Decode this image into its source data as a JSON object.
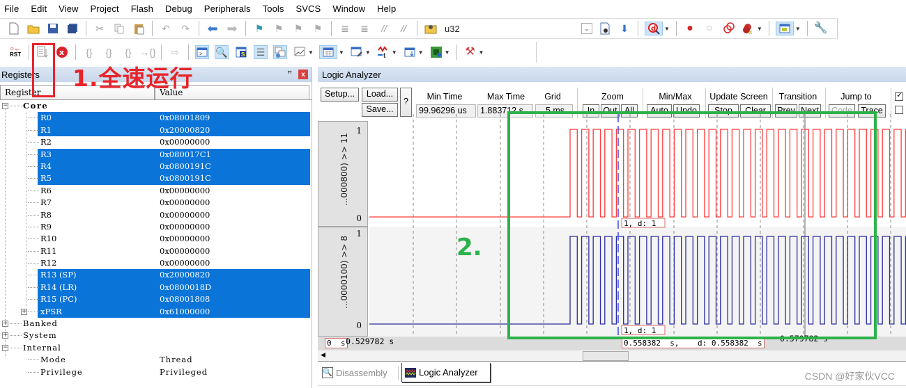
{
  "menu": [
    "File",
    "Edit",
    "View",
    "Project",
    "Flash",
    "Debug",
    "Peripherals",
    "Tools",
    "SVCS",
    "Window",
    "Help"
  ],
  "toolbar1": {
    "icons": [
      "new-file-icon",
      "open-folder-icon",
      "save-icon",
      "save-all-icon",
      "cut-icon",
      "copy-icon",
      "paste-icon",
      "undo-icon",
      "redo-icon",
      "navigate-back-icon",
      "navigate-forward-icon",
      "bookmark-icon",
      "prev-bookmark-icon",
      "next-bookmark-icon",
      "clear-bookmarks-icon",
      "indent-icon",
      "unindent-icon",
      "comment-icon",
      "uncomment-icon",
      "find-in-files-icon"
    ],
    "search_text": "u32",
    "right_icons": [
      "dropdown-icon",
      "find-icon",
      "incremental-find-icon",
      "debug-session-icon",
      "breakpoint-icon",
      "disable-breakpoint-icon",
      "disable-all-breakpoints-icon",
      "kill-all-breakpoints-icon",
      "window-layout-icon",
      "configure-icon"
    ]
  },
  "toolbar2": {
    "icons": [
      "reset-icon",
      "run-icon",
      "stop-icon",
      "step-into-icon",
      "step-over-icon",
      "step-out-icon",
      "run-to-cursor-icon",
      "show-next-statement-icon",
      "command-window-icon",
      "disassembly-window-icon",
      "symbols-window-icon",
      "registers-window-icon",
      "call-stack-icon",
      "watch-windows-icon",
      "memory-windows-icon",
      "serial-windows-icon",
      "analysis-windows-icon",
      "trace-windows-icon",
      "system-viewer-icon",
      "toolbox-icon"
    ],
    "reset_label": "RST"
  },
  "registers": {
    "title": "Registers",
    "col_register": "Register",
    "col_value": "Value",
    "groups": {
      "core": "Core",
      "banked": "Banked",
      "system": "System",
      "internal": "Internal"
    },
    "core": [
      {
        "name": "R0",
        "value": "0x08001809",
        "selected": true
      },
      {
        "name": "R1",
        "value": "0x20000820",
        "selected": true
      },
      {
        "name": "R2",
        "value": "0x00000000",
        "selected": false
      },
      {
        "name": "R3",
        "value": "0x080017C1",
        "selected": true
      },
      {
        "name": "R4",
        "value": "0x0800191C",
        "selected": true
      },
      {
        "name": "R5",
        "value": "0x0800191C",
        "selected": true
      },
      {
        "name": "R6",
        "value": "0x00000000",
        "selected": false
      },
      {
        "name": "R7",
        "value": "0x00000000",
        "selected": false
      },
      {
        "name": "R8",
        "value": "0x00000000",
        "selected": false
      },
      {
        "name": "R9",
        "value": "0x00000000",
        "selected": false
      },
      {
        "name": "R10",
        "value": "0x00000000",
        "selected": false
      },
      {
        "name": "R11",
        "value": "0x00000000",
        "selected": false
      },
      {
        "name": "R12",
        "value": "0x00000000",
        "selected": false
      },
      {
        "name": "R13 (SP)",
        "value": "0x20000820",
        "selected": true
      },
      {
        "name": "R14 (LR)",
        "value": "0x0800018D",
        "selected": true
      },
      {
        "name": "R15 (PC)",
        "value": "0x08001808",
        "selected": true
      },
      {
        "name": "xPSR",
        "value": "0x61000000",
        "selected": true
      }
    ],
    "internal": [
      {
        "name": "Mode",
        "value": "Thread"
      },
      {
        "name": "Privilege",
        "value": "Privileged"
      }
    ]
  },
  "logic_analyzer": {
    "title": "Logic Analyzer",
    "buttons": {
      "setup": "Setup...",
      "load": "Load...",
      "save": "Save...",
      "help": "?",
      "zoom_in": "In",
      "zoom_out": "Out",
      "zoom_all": "All",
      "auto": "Auto",
      "undo": "Undo",
      "stop": "Stop",
      "clear": "Clear",
      "prev": "Prev",
      "next": "Next",
      "code": "Code",
      "trace": "Trace"
    },
    "labels": {
      "min_time": "Min Time",
      "max_time": "Max Time",
      "grid": "Grid",
      "zoom": "Zoom",
      "minmax": "Min/Max",
      "update_screen": "Update Screen",
      "transition": "Transition",
      "jump_to": "Jump to"
    },
    "values": {
      "min_time": "99.96296 us",
      "max_time": "1.883712 s",
      "grid": "5 ms"
    },
    "signals": [
      {
        "label": "...000800) >> 11",
        "high": "1",
        "low": "0",
        "color": "#ff3b3b"
      },
      {
        "label": "...0000100) >> 8",
        "high": "1",
        "low": "0",
        "color": "#2a2aa0"
      }
    ],
    "cursor_value_1": "1,    d: 1",
    "cursor_value_2": "1,    d: 1",
    "time_left_box": "0  s",
    "time_start": "0.529782  s",
    "cursor_time": "0.558382  s,    d: 0.558382  s",
    "time_end": "0.579782  s"
  },
  "tabs": [
    {
      "label": "Disassembly",
      "icon": "disassembly-icon",
      "active": false
    },
    {
      "label": "Logic Analyzer",
      "icon": "logic-analyzer-icon",
      "active": true
    }
  ],
  "annotations": {
    "step1": "1.全速运行",
    "step2": "2."
  },
  "watermark": "CSDN @好家伙VCC",
  "colors": {
    "selection": "#0a74d8",
    "signal1": "#ff3b3b",
    "signal2": "#2a2aa0",
    "annotation_red": "#e8242b",
    "annotation_green": "#2db24a"
  }
}
